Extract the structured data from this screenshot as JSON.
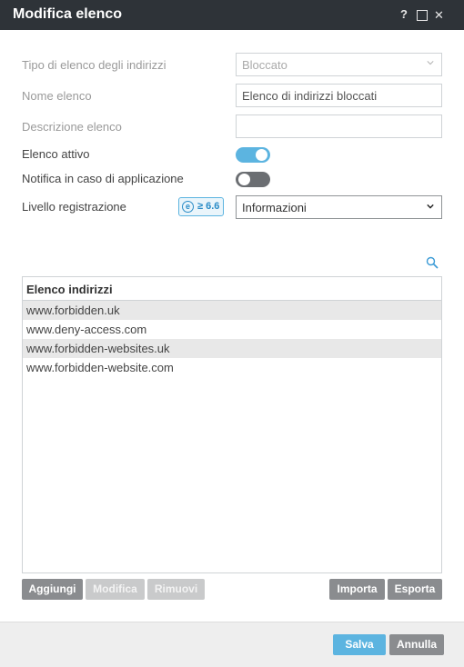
{
  "window": {
    "title": "Modifica elenco",
    "help_glyph": "?",
    "close_glyph": "✕"
  },
  "form": {
    "list_type": {
      "label": "Tipo di elenco degli indirizzi",
      "value": "Bloccato"
    },
    "list_name": {
      "label": "Nome elenco",
      "value": "Elenco di indirizzi bloccati"
    },
    "list_description": {
      "label": "Descrizione elenco",
      "value": ""
    },
    "list_active": {
      "label": "Elenco attivo",
      "on": true
    },
    "notify": {
      "label": "Notifica in caso di applicazione",
      "on": false
    },
    "log_level": {
      "label": "Livello registrazione",
      "value": "Informazioni",
      "badge": "≥ 6.6"
    }
  },
  "address_list": {
    "header": "Elenco indirizzi",
    "rows": [
      "www.forbidden.uk",
      "www.deny-access.com",
      "www.forbidden-websites.uk",
      "www.forbidden-website.com"
    ]
  },
  "actions": {
    "add": "Aggiungi",
    "edit": "Modifica",
    "remove": "Rimuovi",
    "import": "Importa",
    "export": "Esporta"
  },
  "footer": {
    "save": "Salva",
    "cancel": "Annulla"
  },
  "colors": {
    "titlebar": "#2e3338",
    "accent": "#5cb4e0",
    "button_gray": "#8a8c8f",
    "button_disabled": "#c9cacb"
  },
  "icons": [
    "help-icon",
    "maximize-icon",
    "close-icon",
    "chevron-down-icon",
    "search-icon",
    "eset-version-icon"
  ]
}
